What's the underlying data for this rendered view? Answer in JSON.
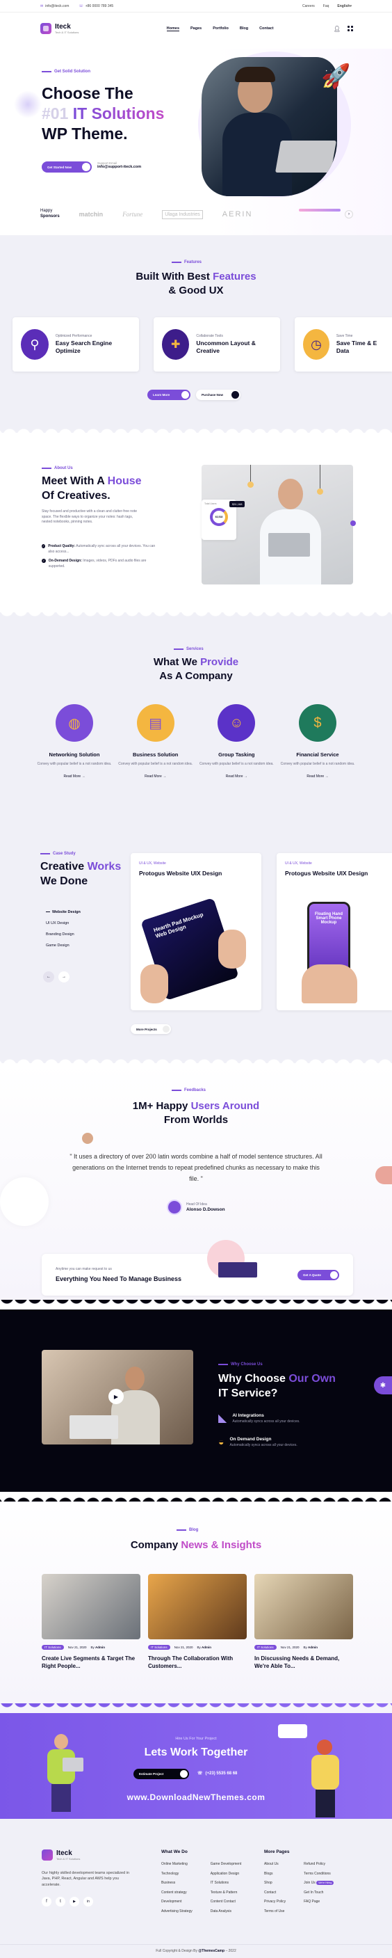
{
  "topbar": {
    "email": "info@iteck.com",
    "phone": "+86 0000 789 345",
    "links": [
      "Careers",
      "Faq",
      "English"
    ]
  },
  "header": {
    "brand": "Iteck",
    "brand_sub": "Tech & IT Solutions",
    "nav": [
      "Homes",
      "Pages",
      "Portfolio",
      "Blog",
      "Contact"
    ]
  },
  "hero": {
    "tag": "Get Solid Solution",
    "title_1": "Choose The",
    "title_num": "#01",
    "title_accent": "IT Solutions",
    "title_3": "WP Theme.",
    "cta": "Get Started Now",
    "support_label": "Support Email",
    "support_email": "info@support-iteck.com"
  },
  "sponsors": {
    "label_1": "Happy",
    "label_2": "Sponsors",
    "logos": [
      "matchin",
      "Fortune",
      "Ulaga Industries",
      "AERIN"
    ]
  },
  "features": {
    "tag": "Features",
    "title_1": "Built With Best",
    "title_accent": "Features",
    "title_2": "& Good UX",
    "items": [
      {
        "sub": "Optimized Performance",
        "title": "Easy Search Engine Optimize"
      },
      {
        "sub": "Collaborate Tools",
        "title": "Uncommon Layout & Creative"
      },
      {
        "sub": "Save Time",
        "title": "Save Time & E Data"
      }
    ],
    "btn_1": "Learn More",
    "btn_2": "Purchase Now"
  },
  "about": {
    "tag": "About Us",
    "title_1": "Meet With A",
    "title_accent": "House",
    "title_2": "Of Creatives.",
    "desc": "Stay focused and productive with a clean and clutter-free note space. The flexible ways to organize your notes: hash tags, nested notebooks, pinning notes.",
    "points": [
      {
        "title": "Product Quality:",
        "text": "Automatically sync across all your devices. You can also access..."
      },
      {
        "title": "On-Demand Design:",
        "text": "Images, videos, PDFs and audio files are supported."
      }
    ],
    "widget_title": "Total Users",
    "widget_value": "62,518",
    "widget_badge": "$31,168"
  },
  "services": {
    "tag": "Services",
    "title_1": "What We",
    "title_accent": "Provide",
    "title_2": "As A Company",
    "items": [
      {
        "title": "Networking Solution",
        "desc": "Convey with popular belief is a not random idea.",
        "more": "Read More →",
        "color": "#7b4dd9"
      },
      {
        "title": "Business Solution",
        "desc": "Convey with popular belief is a not random idea.",
        "more": "Read More →",
        "color": "#f4b640"
      },
      {
        "title": "Group Tasking",
        "desc": "Convey with popular belief is a not random idea.",
        "more": "Read More →",
        "color": "#5b32c8"
      },
      {
        "title": "Financial Service",
        "desc": "Convey with popular belief is a not random idea.",
        "more": "Read More →",
        "color": "#1f7a5c"
      }
    ]
  },
  "case": {
    "tag": "Case Study",
    "title_1": "Creative",
    "title_accent": "Works",
    "title_2": "We Done",
    "categories": [
      "Website Design",
      "UI UX Design",
      "Branding Design",
      "Game Design"
    ],
    "cards": [
      {
        "sub": "UI & UX, Website",
        "title": "Protogus Website UIX Design",
        "screen": "Hearth Pad Mockup Web Design"
      },
      {
        "sub": "UI & UX, Website",
        "title": "Protogus Website UIX Design",
        "screen": "Floating Hand Smart Phone Mockup"
      }
    ],
    "more": "More Projects"
  },
  "testimonial": {
    "tag": "Feedbacks",
    "title_1": "1M+ Happy",
    "title_accent": "Users Around",
    "title_2": "From Worlds",
    "quote": "\" It uses a directory of over 200 latin words combine a half of model sentence structures. All generations on the Internet trends to repeat predefined chunks as necessary to make this file. \"",
    "role": "Head Of Idea",
    "name": "Alonso D.Dowson"
  },
  "manage": {
    "sub": "Anytime you can make request to us",
    "title": "Everything You Need To Manage Business",
    "btn": "Get A Quote"
  },
  "why": {
    "tag": "Why Choose Us",
    "title_1": "Why Choose",
    "title_accent": "Our Own",
    "title_2": "IT Service?",
    "items": [
      {
        "title": "AI Integrations",
        "text": "Automatically syncs across all your devices."
      },
      {
        "title": "On Demand Design",
        "text": "Automatically syncs across all your devices."
      }
    ]
  },
  "blog": {
    "tag": "Blog",
    "title_1": "Company",
    "title_accent": "News & Insights",
    "posts": [
      {
        "cat": "IT Solutions",
        "date": "Nov 21, 2020",
        "by": "By",
        "author": "Admin",
        "title": "Create Live Segments & Target The Right People..."
      },
      {
        "cat": "IT Solutions",
        "date": "Nov 21, 2020",
        "by": "By",
        "author": "Admin",
        "title": "Through The Collaboration With Customers..."
      },
      {
        "cat": "IT Solutions",
        "date": "Nov 21, 2020",
        "by": "By",
        "author": "Admin",
        "title": "In Discussing Needs & Demand, We're Able To..."
      }
    ]
  },
  "cta": {
    "sub": "Hire Us For Your Project",
    "title": "Lets Work Together",
    "btn": "Estimate Project",
    "phone": "(+23) 5535 68 68",
    "watermark": "www.DownloadNewThemes.com"
  },
  "footer": {
    "brand": "Iteck",
    "brand_sub": "Tech & IT Solutions",
    "desc": "Our highly skilled development teams specialized in Java, PHP, React, Angular and AWS help you accelerate.",
    "col1_title": "What We Do",
    "col1_a": [
      "Online Marketing",
      "Technology",
      "Business",
      "Content strategy",
      "Development",
      "Advertising Strategy"
    ],
    "col1_b": [
      "Game Development",
      "Application Design",
      "IT Solutions",
      "Texture & Pattern",
      "Content Contact",
      "Data Analysis"
    ],
    "col2_title": "More Pages",
    "col2_a": [
      "About Us",
      "Blogs",
      "Shop",
      "Contact",
      "Privacy Policy",
      "Terms of Use"
    ],
    "col2_b": [
      "Refund Policy",
      "Terms Conditions",
      "Join Us",
      "Get In Touch",
      "FAQ Page"
    ],
    "hiring": "We're Hiring",
    "copyright": "Full Copyright & Design By",
    "copyright_brand": "@ThemesCamp",
    "copyright_year": "– 2022"
  },
  "colors": {
    "accent": "#7b4dd9",
    "pink": "#c04cc8",
    "dark": "#0d0d25",
    "bg_gray": "#f0f0f7"
  }
}
